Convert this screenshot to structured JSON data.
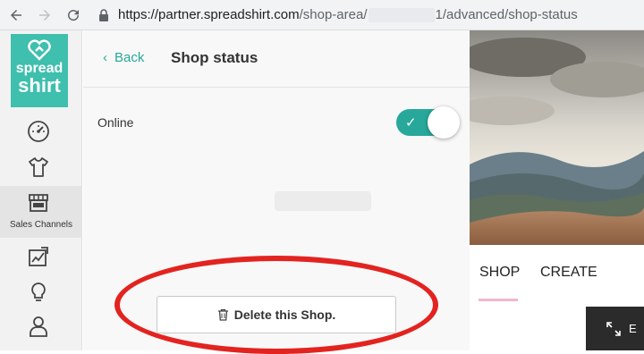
{
  "browser": {
    "url_host": "https://partner.spreadshirt.com",
    "url_path_1": "/shop-area/",
    "url_path_2": "1/advanced/shop-status"
  },
  "sidebar": {
    "logo_line1": "spread",
    "logo_line2": "shirt",
    "active_label": "Sales Channels",
    "brand_color": "#3fbfad"
  },
  "header": {
    "back_label": "Back",
    "title": "Shop status"
  },
  "settings": {
    "online_label": "Online",
    "online_enabled": true,
    "toggle_color": "#27a89a"
  },
  "actions": {
    "delete_label": "Delete this Shop."
  },
  "preview": {
    "tab_shop": "SHOP",
    "tab_create": "CREATE",
    "expand_label": "E"
  },
  "annotation": {
    "ellipse_color": "#e3231f"
  }
}
